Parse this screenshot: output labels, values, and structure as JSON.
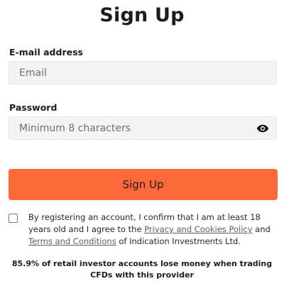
{
  "page": {
    "title": "Sign Up"
  },
  "form": {
    "email": {
      "label": "E-mail address",
      "placeholder": "Email",
      "value": ""
    },
    "password": {
      "label": "Password",
      "placeholder": "Minimum 8 characters",
      "value": "",
      "toggle_icon": "eye-icon"
    },
    "submit_label": "Sign Up",
    "consent": {
      "checked": false,
      "text_before": "By registering an account, I confirm that I am at least 18 years old and I agree to the ",
      "privacy_link": "Privacy and Cookies Policy",
      "text_middle": " and ",
      "terms_link": "Terms and Conditions",
      "text_after": " of Indication Investments Ltd."
    }
  },
  "risk_warning": {
    "line1": "85.9% of retail investor accounts lose money when trading",
    "line2": "CFDs with this provider"
  },
  "colors": {
    "accent": "#fd6a3a",
    "input_bg": "#f4f4f4"
  }
}
